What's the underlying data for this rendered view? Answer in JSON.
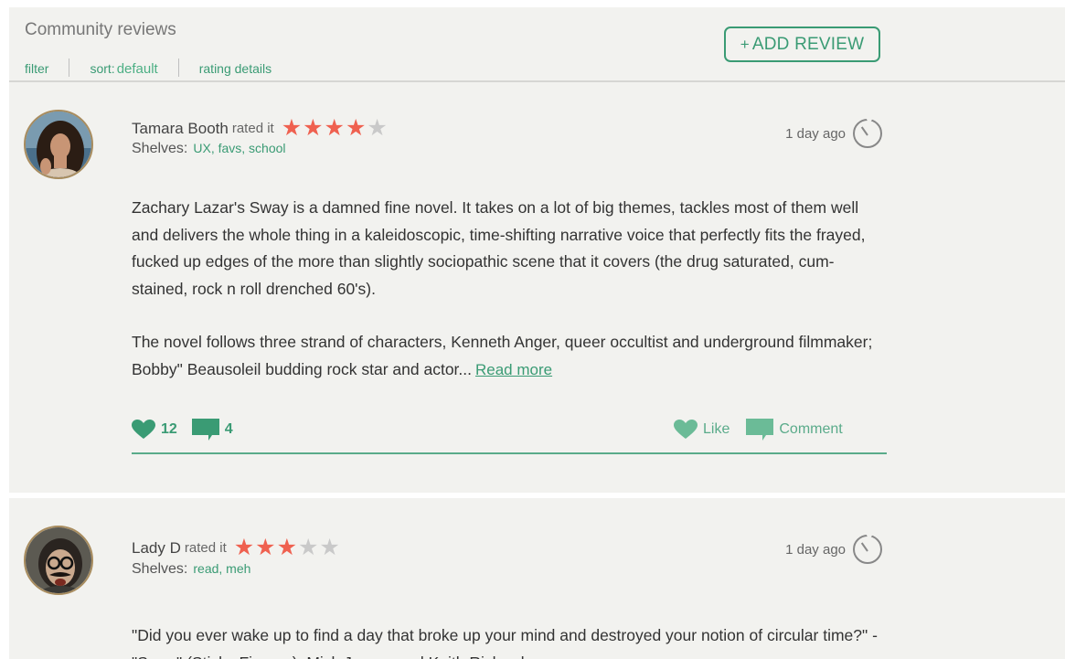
{
  "header": {
    "title": "Community reviews",
    "filter_label": "filter",
    "sort_label": "sort:",
    "sort_value": "default",
    "rating_details_label": "rating details",
    "add_review_plus": "+",
    "add_review_label": "ADD REVIEW"
  },
  "reviews": [
    {
      "user": "Tamara Booth",
      "rated_label": "rated it",
      "rating": 4,
      "rating_max": 5,
      "shelves_label": "Shelves:",
      "shelves": "UX, favs, school",
      "time": "1 day ago",
      "paragraphs": [
        "Zachary Lazar's Sway is a damned fine novel. It takes on a lot of big themes, tackles most of them well and delivers the whole thing in a kaleidoscopic, time-shifting narrative voice that perfectly fits the frayed, fucked up edges of the more than slightly sociopathic scene that it covers (the drug saturated, cum-stained, rock n roll drenched 60's).",
        "The novel follows three strand of characters, Kenneth Anger, queer occultist and underground filmmaker; Bobby\" Beausoleil budding rock star and actor..."
      ],
      "read_more": "Read more",
      "likes": "12",
      "comments": "4",
      "like_label": "Like",
      "comment_label": "Comment"
    },
    {
      "user": "Lady D",
      "rated_label": "rated it",
      "rating": 3,
      "rating_max": 5,
      "shelves_label": "Shelves:",
      "shelves": "read, meh",
      "time": "1 day ago",
      "paragraphs": [
        "\"Did you ever wake up to find a day that broke up your mind and destroyed your notion of circular time?\" - \"Sway\" (Sticky Fingers), Mick Jagger and Keith Richards."
      ]
    }
  ],
  "colors": {
    "accent": "#3a9b74",
    "star_on": "#ef6150",
    "star_off": "#c9c9c9",
    "background": "#f2f2ef"
  }
}
